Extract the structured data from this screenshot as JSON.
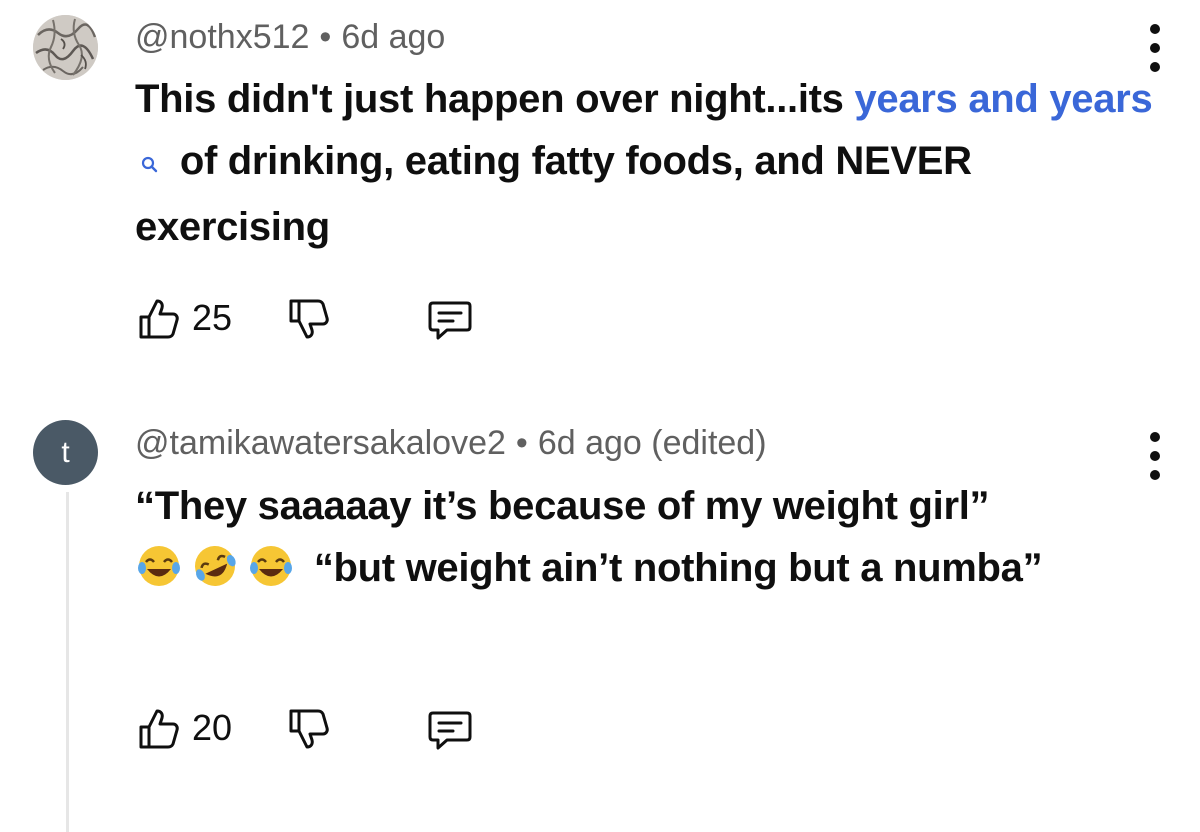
{
  "comments": [
    {
      "username": "@nothx512",
      "separator": "•",
      "time": "6d ago",
      "text_part1": "This didn't just happen over night...its ",
      "link_text": "years and years",
      "text_part2": " of drinking, eating fatty foods, and NEVER exercising",
      "like_count": "25",
      "avatar_icon": "marble-texture-avatar"
    },
    {
      "avatar_letter": "t",
      "username": "@tamikawatersakalove2",
      "separator": "•",
      "time": "6d ago (edited)",
      "text_part1": "“They saaaaay it’s because of my weight girl”",
      "emojis": [
        "😂",
        "🤣",
        "😂"
      ],
      "text_part2": " “but weight ain’t nothing but a numba”",
      "like_count": "20"
    }
  ],
  "colors": {
    "link": "#3a67d8",
    "meta": "#606060",
    "text": "#0f0f0f",
    "avatar_letter_bg": "#4a5966"
  }
}
